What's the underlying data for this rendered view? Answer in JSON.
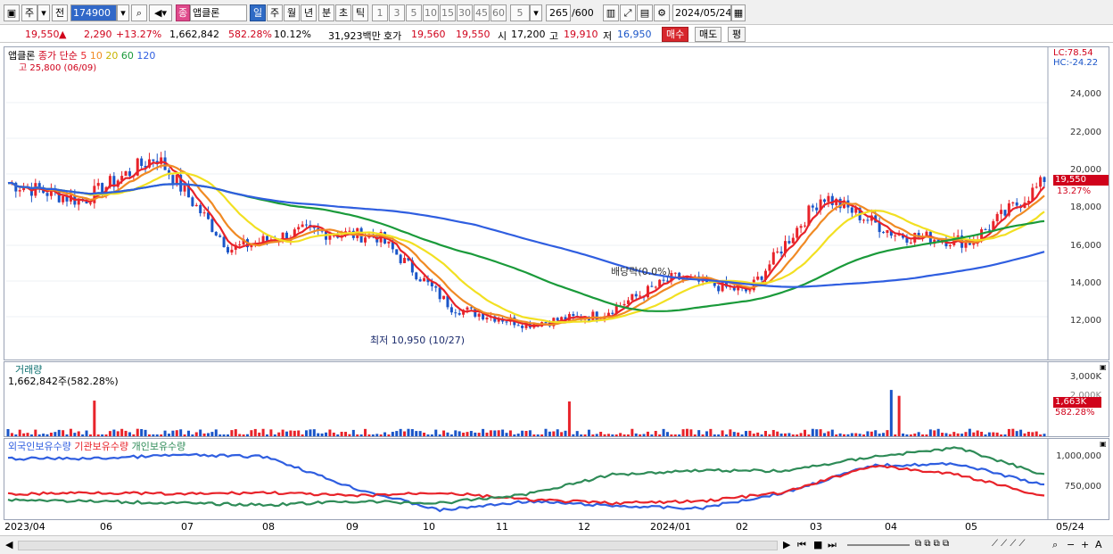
{
  "toolbar": {
    "period_unit": "주",
    "prev_label": "전",
    "stock_code": "174900",
    "stock_badge": "종",
    "stock_name": "앱클론",
    "periods": [
      "일",
      "주",
      "월",
      "년",
      "분",
      "초",
      "틱"
    ],
    "intervals": [
      "1",
      "3",
      "5",
      "10",
      "15",
      "30",
      "45",
      "60"
    ],
    "interval_value": "5",
    "count_value": "265",
    "count_total": "/600",
    "date_value": "2024/05/24"
  },
  "quote": {
    "price": "19,550",
    "arrow": "▲",
    "change": "2,290",
    "change_pct": "+13.27%",
    "volume": "1,662,842",
    "volume_ratio": "582.28%",
    "turnover_pct": "10.12%",
    "amount": "31,923백만",
    "hoga_label": "호가",
    "ask": "19,560",
    "bid": "19,550",
    "open_label": "시",
    "open": "17,200",
    "high_label": "고",
    "high": "19,910",
    "low_label": "저",
    "low": "16,950",
    "buy_label": "매수",
    "sell_label": "매도",
    "avg_label": "평"
  },
  "main_chart": {
    "stock_name": "앱클론",
    "ma_label": "종가 단순",
    "ma_periods": [
      "5",
      "10",
      "20",
      "60",
      "120"
    ],
    "ma_colors": [
      "#e8232a",
      "#f08a24",
      "#f2e022",
      "#1a9a3a",
      "#2f5ee0"
    ],
    "high_marker": "고 25,800 (06/09)",
    "low_marker": "최저 10,950 (10/27)",
    "dividend_marker": "배당락(0.0%)",
    "lc": "LC:78.54",
    "hc": "HC:-24.22",
    "price_ticks": [
      "24,000",
      "22,000",
      "20,000",
      "18,000",
      "16,000",
      "14,000",
      "12,000"
    ],
    "current_price": "19,550",
    "current_pct": "13.27%"
  },
  "volume_chart": {
    "title": "거래량",
    "current": "1,662,842주(582.28%)",
    "ticks": [
      "3,000K",
      "2,000K"
    ],
    "badge": "1,663K",
    "badge_pct": "582.28%"
  },
  "holdings_chart": {
    "legend": [
      "외국인보유수량",
      "기관보유수량",
      "개인보유수량"
    ],
    "colors": [
      "#2f5ee0",
      "#e8232a",
      "#2e8b57"
    ],
    "ticks": [
      "1,000,000",
      "750,000"
    ]
  },
  "x_axis": [
    "2023/04",
    "06",
    "07",
    "08",
    "09",
    "10",
    "11",
    "12",
    "2024/01",
    "02",
    "03",
    "04",
    "05",
    "05/24"
  ],
  "chart_data": {
    "type": "line",
    "title": "앱클론",
    "series": [
      {
        "name": "종가",
        "x": [
          "2023/04",
          "2023/05",
          "2023/06",
          "2023/07",
          "2023/08",
          "2023/09",
          "2023/10",
          "2023/11",
          "2023/12",
          "2024/01",
          "2024/02",
          "2024/03",
          "2024/04",
          "2024/05",
          "2024/05/24"
        ],
        "values": [
          19500,
          18500,
          21000,
          15800,
          16800,
          16500,
          12500,
          11600,
          12100,
          14200,
          13400,
          18800,
          16600,
          16200,
          19550
        ]
      }
    ],
    "ylim": [
      10000,
      26000
    ],
    "annotations": [
      "고 25,800 (06/09)",
      "최저 10,950 (10/27)",
      "배당락(0.0%)"
    ]
  }
}
